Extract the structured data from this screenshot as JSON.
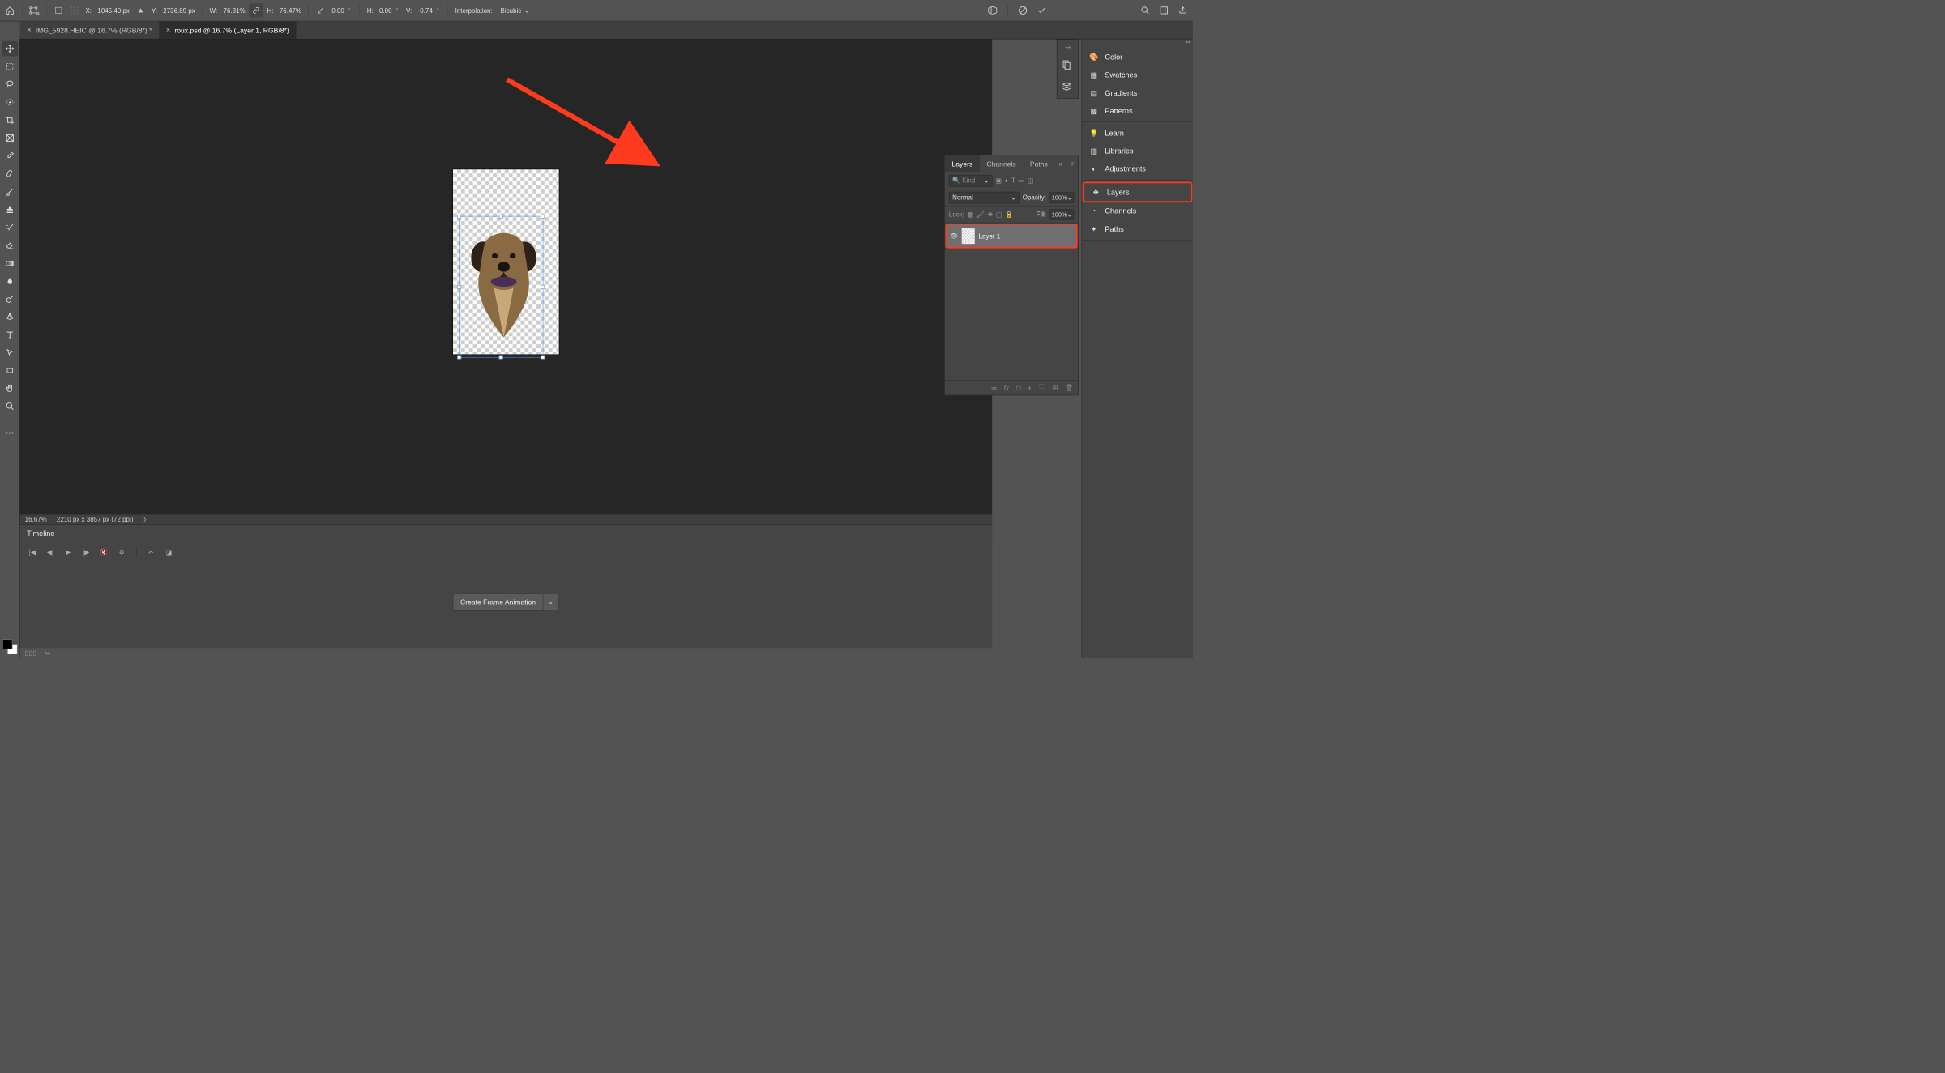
{
  "optbar": {
    "x_label": "X:",
    "x_val": "1045.40 px",
    "y_label": "Y:",
    "y_val": "2736.89 px",
    "w_label": "W:",
    "w_val": "76.31%",
    "h_label": "H:",
    "h_val": "76.47%",
    "rot_val": "0.00",
    "skew_h_label": "H:",
    "skew_h_val": "0.00",
    "skew_v_label": "V:",
    "skew_v_val": "-0.74",
    "interp_label": "Interpolation:",
    "interp_val": "Bicubic"
  },
  "tabs": [
    {
      "label": "IMG_5928.HEIC @ 16.7% (RGB/8*) *"
    },
    {
      "label": "roux.psd @ 16.7% (Layer 1, RGB/8*)"
    }
  ],
  "status": {
    "zoom": "16.67%",
    "dims": "2210 px x 3857 px (72 ppi)"
  },
  "timeline": {
    "title": "Timeline",
    "button": "Create Frame Animation"
  },
  "layers_panel": {
    "tabs": [
      "Layers",
      "Channels",
      "Paths"
    ],
    "filter_placeholder": "Kind",
    "blend": "Normal",
    "opacity_label": "Opacity:",
    "opacity_val": "100%",
    "lock_label": "Lock:",
    "fill_label": "Fill:",
    "fill_val": "100%",
    "layer_name": "Layer 1"
  },
  "right": {
    "group1": [
      "Color",
      "Swatches",
      "Gradients",
      "Patterns"
    ],
    "group2": [
      "Learn",
      "Libraries",
      "Adjustments"
    ],
    "group3": [
      "Layers",
      "Channels",
      "Paths"
    ]
  }
}
